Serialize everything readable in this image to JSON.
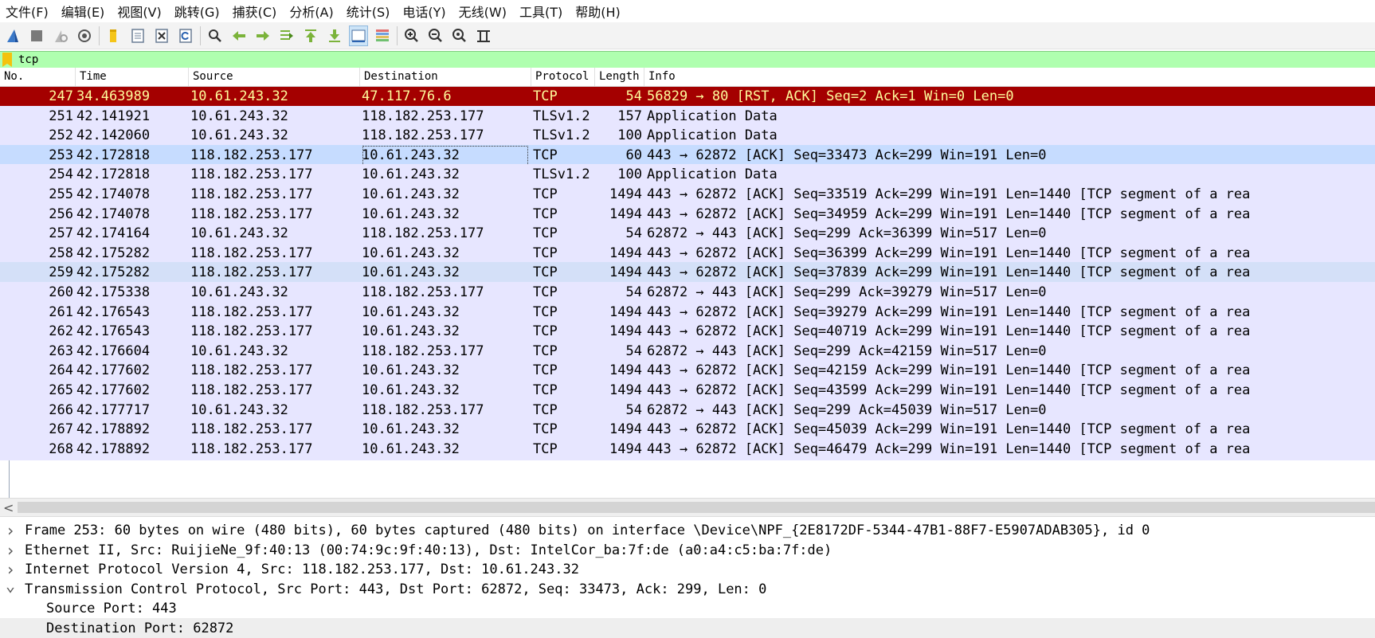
{
  "menubar": {
    "items": [
      "文件(F)",
      "编辑(E)",
      "视图(V)",
      "跳转(G)",
      "捕获(C)",
      "分析(A)",
      "统计(S)",
      "电话(Y)",
      "无线(W)",
      "工具(T)",
      "帮助(H)"
    ]
  },
  "toolbar": {
    "buttons": [
      "shark-fin-start-icon",
      "stop-square-icon",
      "restart-fin-icon",
      "capture-options-gear-icon",
      "open-file-folder-icon",
      "save-file-icon",
      "close-file-icon",
      "reload-icon",
      "find-magnifier-icon",
      "go-back-arrow-icon",
      "go-forward-arrow-icon",
      "go-to-packet-icon",
      "go-first-icon",
      "go-last-icon",
      "autoscroll-icon",
      "colorize-icon",
      "zoom-in-icon",
      "zoom-out-icon",
      "zoom-normal-icon",
      "resize-columns-icon"
    ],
    "active_button": "autoscroll-icon"
  },
  "filter": {
    "value": "tcp"
  },
  "columns": [
    "No.",
    "Time",
    "Source",
    "Destination",
    "Protocol",
    "Length",
    "Info"
  ],
  "colors": {
    "row_default": "#e7e6ff",
    "row_selected": "#c6dcff",
    "row_highlight": "#d4e0f8",
    "row_rst_bg": "#a40000",
    "row_rst_fg": "#fffc9c",
    "filter_ok": "#afffaf"
  },
  "packets": [
    {
      "no": "247",
      "time": "34.463989",
      "src": "10.61.243.32",
      "dst": "47.117.76.6",
      "proto": "TCP",
      "len": "54",
      "info": "56829 → 80 [RST, ACK] Seq=2 Ack=1 Win=0 Len=0",
      "style": "rst"
    },
    {
      "no": "251",
      "time": "42.141921",
      "src": "10.61.243.32",
      "dst": "118.182.253.177",
      "proto": "TLSv1.2",
      "len": "157",
      "info": "Application Data",
      "style": "normal"
    },
    {
      "no": "252",
      "time": "42.142060",
      "src": "10.61.243.32",
      "dst": "118.182.253.177",
      "proto": "TLSv1.2",
      "len": "100",
      "info": "Application Data",
      "style": "normal"
    },
    {
      "no": "253",
      "time": "42.172818",
      "src": "118.182.253.177",
      "dst": "10.61.243.32",
      "proto": "TCP",
      "len": "60",
      "info": "443 → 62872 [ACK] Seq=33473 Ack=299 Win=191 Len=0",
      "style": "selected"
    },
    {
      "no": "254",
      "time": "42.172818",
      "src": "118.182.253.177",
      "dst": "10.61.243.32",
      "proto": "TLSv1.2",
      "len": "100",
      "info": "Application Data",
      "style": "normal"
    },
    {
      "no": "255",
      "time": "42.174078",
      "src": "118.182.253.177",
      "dst": "10.61.243.32",
      "proto": "TCP",
      "len": "1494",
      "info": "443 → 62872 [ACK] Seq=33519 Ack=299 Win=191 Len=1440 [TCP segment of a rea",
      "style": "normal"
    },
    {
      "no": "256",
      "time": "42.174078",
      "src": "118.182.253.177",
      "dst": "10.61.243.32",
      "proto": "TCP",
      "len": "1494",
      "info": "443 → 62872 [ACK] Seq=34959 Ack=299 Win=191 Len=1440 [TCP segment of a rea",
      "style": "normal"
    },
    {
      "no": "257",
      "time": "42.174164",
      "src": "10.61.243.32",
      "dst": "118.182.253.177",
      "proto": "TCP",
      "len": "54",
      "info": "62872 → 443 [ACK] Seq=299 Ack=36399 Win=517 Len=0",
      "style": "normal"
    },
    {
      "no": "258",
      "time": "42.175282",
      "src": "118.182.253.177",
      "dst": "10.61.243.32",
      "proto": "TCP",
      "len": "1494",
      "info": "443 → 62872 [ACK] Seq=36399 Ack=299 Win=191 Len=1440 [TCP segment of a rea",
      "style": "normal"
    },
    {
      "no": "259",
      "time": "42.175282",
      "src": "118.182.253.177",
      "dst": "10.61.243.32",
      "proto": "TCP",
      "len": "1494",
      "info": "443 → 62872 [ACK] Seq=37839 Ack=299 Win=191 Len=1440 [TCP segment of a rea",
      "style": "highlight"
    },
    {
      "no": "260",
      "time": "42.175338",
      "src": "10.61.243.32",
      "dst": "118.182.253.177",
      "proto": "TCP",
      "len": "54",
      "info": "62872 → 443 [ACK] Seq=299 Ack=39279 Win=517 Len=0",
      "style": "normal"
    },
    {
      "no": "261",
      "time": "42.176543",
      "src": "118.182.253.177",
      "dst": "10.61.243.32",
      "proto": "TCP",
      "len": "1494",
      "info": "443 → 62872 [ACK] Seq=39279 Ack=299 Win=191 Len=1440 [TCP segment of a rea",
      "style": "normal"
    },
    {
      "no": "262",
      "time": "42.176543",
      "src": "118.182.253.177",
      "dst": "10.61.243.32",
      "proto": "TCP",
      "len": "1494",
      "info": "443 → 62872 [ACK] Seq=40719 Ack=299 Win=191 Len=1440 [TCP segment of a rea",
      "style": "normal"
    },
    {
      "no": "263",
      "time": "42.176604",
      "src": "10.61.243.32",
      "dst": "118.182.253.177",
      "proto": "TCP",
      "len": "54",
      "info": "62872 → 443 [ACK] Seq=299 Ack=42159 Win=517 Len=0",
      "style": "normal"
    },
    {
      "no": "264",
      "time": "42.177602",
      "src": "118.182.253.177",
      "dst": "10.61.243.32",
      "proto": "TCP",
      "len": "1494",
      "info": "443 → 62872 [ACK] Seq=42159 Ack=299 Win=191 Len=1440 [TCP segment of a rea",
      "style": "normal"
    },
    {
      "no": "265",
      "time": "42.177602",
      "src": "118.182.253.177",
      "dst": "10.61.243.32",
      "proto": "TCP",
      "len": "1494",
      "info": "443 → 62872 [ACK] Seq=43599 Ack=299 Win=191 Len=1440 [TCP segment of a rea",
      "style": "normal"
    },
    {
      "no": "266",
      "time": "42.177717",
      "src": "10.61.243.32",
      "dst": "118.182.253.177",
      "proto": "TCP",
      "len": "54",
      "info": "62872 → 443 [ACK] Seq=299 Ack=45039 Win=517 Len=0",
      "style": "normal"
    },
    {
      "no": "267",
      "time": "42.178892",
      "src": "118.182.253.177",
      "dst": "10.61.243.32",
      "proto": "TCP",
      "len": "1494",
      "info": "443 → 62872 [ACK] Seq=45039 Ack=299 Win=191 Len=1440 [TCP segment of a rea",
      "style": "normal"
    },
    {
      "no": "268",
      "time": "42.178892",
      "src": "118.182.253.177",
      "dst": "10.61.243.32",
      "proto": "TCP",
      "len": "1494",
      "info": "443 → 62872 [ACK] Seq=46479 Ack=299 Win=191 Len=1440 [TCP segment of a rea",
      "style": "normal"
    }
  ],
  "details": [
    {
      "text": "Frame 253: 60 bytes on wire (480 bits), 60 bytes captured (480 bits) on interface \\Device\\NPF_{2E8172DF-5344-47B1-88F7-E5907ADAB305}, id 0",
      "expanded": false,
      "child": false
    },
    {
      "text": "Ethernet II, Src: RuijieNe_9f:40:13 (00:74:9c:9f:40:13), Dst: IntelCor_ba:7f:de (a0:a4:c5:ba:7f:de)",
      "expanded": false,
      "child": false
    },
    {
      "text": "Internet Protocol Version 4, Src: 118.182.253.177, Dst: 10.61.243.32",
      "expanded": false,
      "child": false
    },
    {
      "text": "Transmission Control Protocol, Src Port: 443, Dst Port: 62872, Seq: 33473, Ack: 299, Len: 0",
      "expanded": true,
      "child": false
    },
    {
      "text": "Source Port: 443",
      "expanded": null,
      "child": true
    },
    {
      "text": "Destination Port: 62872",
      "expanded": null,
      "child": true
    }
  ]
}
